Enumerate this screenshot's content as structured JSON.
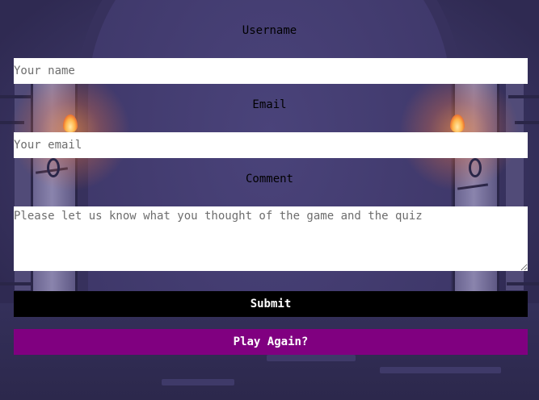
{
  "form": {
    "username": {
      "label": "Username",
      "placeholder": "Your name",
      "value": ""
    },
    "email": {
      "label": "Email",
      "placeholder": "Your email",
      "value": ""
    },
    "comment": {
      "label": "Comment",
      "placeholder": "Please let us know what you thought of the game and the quiz",
      "value": ""
    },
    "submit_label": "Submit"
  },
  "play_again_label": "Play Again?",
  "colors": {
    "submit_bg": "#000000",
    "play_again_bg": "#800080",
    "background": "#3a3560"
  },
  "background_icons": [
    "dungeon-archway",
    "wall-torch-left",
    "wall-torch-right"
  ]
}
